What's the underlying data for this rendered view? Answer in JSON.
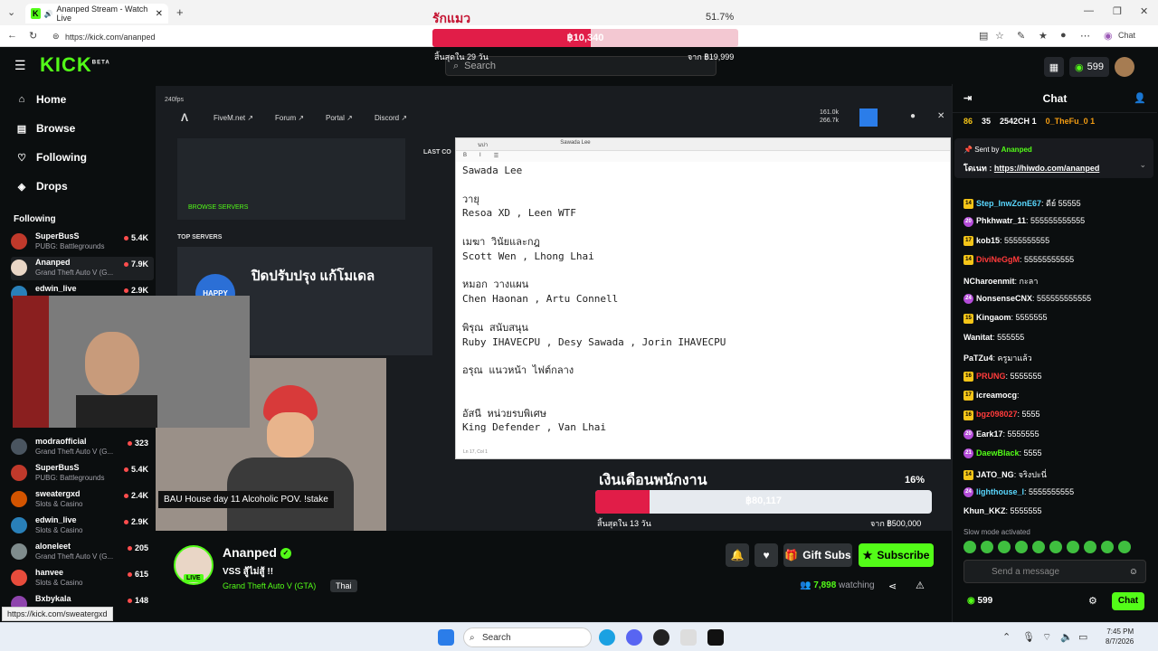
{
  "browser": {
    "tab_title": "Ananped Stream - Watch Live",
    "url": "https://kick.com/ananped",
    "chat_label": "Chat",
    "status_url": "https://kick.com/sweatergxd"
  },
  "goal": {
    "title": "รักแมว",
    "percent": "51.7%",
    "value_label": "฿10,340",
    "fill_fraction": 0.517,
    "left_caption": "สิ้นสุดใน 29 วัน",
    "right_caption": "จาก ฿19,999"
  },
  "header": {
    "logo": "KICK",
    "logo_tag": "BETA",
    "search_placeholder": "Search",
    "points": "599"
  },
  "sidebar": {
    "nav": [
      {
        "label": "Home",
        "icon": "home-icon"
      },
      {
        "label": "Browse",
        "icon": "browse-icon"
      },
      {
        "label": "Following",
        "icon": "heart-icon"
      },
      {
        "label": "Drops",
        "icon": "drops-icon"
      }
    ],
    "section_title": "Following",
    "channels": [
      {
        "name": "SuperBusS",
        "game": "PUBG: Battlegrounds",
        "viewers": "5.4K"
      },
      {
        "name": "Ananped",
        "game": "Grand Theft Auto V (G...",
        "viewers": "7.9K"
      },
      {
        "name": "edwin_live",
        "game": "",
        "viewers": "2.9K"
      },
      {
        "name": "modraofficial",
        "game": "Grand Theft Auto V (G...",
        "viewers": "323"
      },
      {
        "name": "SuperBusS",
        "game": "PUBG: Battlegrounds",
        "viewers": "5.4K"
      },
      {
        "name": "sweatergxd",
        "game": "Slots & Casino",
        "viewers": "2.4K"
      },
      {
        "name": "edwin_live",
        "game": "Slots & Casino",
        "viewers": "2.9K"
      },
      {
        "name": "aloneleet",
        "game": "Grand Theft Auto V (G...",
        "viewers": "205"
      },
      {
        "name": "hanvee",
        "game": "Slots & Casino",
        "viewers": "615"
      },
      {
        "name": "Bxbykala",
        "game": "",
        "viewers": "148"
      }
    ]
  },
  "video": {
    "fps": "240fps",
    "top_links": [
      "FiveM.net ↗",
      "Forum ↗",
      "Portal ↗",
      "Discord ↗"
    ],
    "stats": [
      "161.0k",
      "266.7k"
    ],
    "browse_servers": "BROWSE SERVERS",
    "last_connected": "LAST CO",
    "top_servers": "TOP SERVERS",
    "banner_title": "ปิดปรับปรุง แก้โมเดล",
    "banner_logo": "HAPPY",
    "caption": "BAU House day 11 Alcoholic POV. !stake",
    "notepad_lines": "Sawada Lee\n\nวายุ\nResoa XD , Leen WTF\n\nเมฆา วินัยและกฎ\nScott Wen , Lhong Lhai\n\nหมอก วางแผน\nChen Haonan , Artu Connell\n\nพิรุณ สนับสนุน\nRuby IHAVECPU , Desy Sawada , Jorin IHAVECPU\n\nอรุณ แนวหน้า ไฟต์กลาง\n\n\nอัสนี หน่วยรบพิเศษ\nKing Defender , Van Lhai",
    "notepad_tab1": "นบ่า",
    "notepad_tab2": "Sawada Lee",
    "notepad_status": "Ln 17, Col 1",
    "donate_value": "฿80,117",
    "donate_fraction": 0.16,
    "donate_pct": "16%",
    "donate_banner": "เงินเดือนพนักงาน",
    "donate_left": "สิ้นสุดใน 13 วัน",
    "donate_right": "จาก ฿500,000"
  },
  "stream": {
    "name": "Ananped",
    "live": "LIVE",
    "title": "VSS สู้ไม่สู้ !!",
    "category": "Grand Theft Auto V (GTA)",
    "language": "Thai",
    "gift_label": "Gift Subs",
    "subscribe_label": "Subscribe",
    "watching": "7,898",
    "watching_suffix": "watching"
  },
  "chat": {
    "title": "Chat",
    "leaderboard": [
      {
        "rank": "86",
        "points": "35"
      },
      {
        "name": "2542CH",
        "count": "1"
      },
      {
        "name": "0_TheFu_0",
        "count": "1"
      }
    ],
    "pinned_by_label": "Sent by",
    "pinned_by": "Ananped",
    "pinned_text_prefix": "โดเนท : ",
    "pinned_link": "https://hiwdo.com/ananped",
    "messages": [
      {
        "badge": "14",
        "user": "Step_InwZonE67",
        "color": "#5ad8ff",
        "text": ": ดีย์ 55555"
      },
      {
        "badge": "20",
        "user": "Phkhwatr_11",
        "color": "#ffffff",
        "text": ": 555555555555"
      },
      {
        "badge": "17",
        "user": "kob15",
        "color": "#ffffff",
        "text": ": 5555555555"
      },
      {
        "badge": "14",
        "user": "DiviNeGgM",
        "color": "#ff3b3b",
        "text": ": 55555555555"
      },
      {
        "badge": "",
        "user": "NCharoenmit",
        "color": "#ffffff",
        "text": ": กะลา"
      },
      {
        "badge": "24",
        "user": "NonsenseCNX",
        "color": "#ffffff",
        "text": ": 555555555555"
      },
      {
        "badge": "15",
        "user": "Kingaom",
        "color": "#ffffff",
        "text": ": 5555555"
      },
      {
        "badge": "",
        "user": "Wanitat",
        "color": "#ffffff",
        "text": ": 555555"
      },
      {
        "badge": "",
        "user": "PaTZu4",
        "color": "#ffffff",
        "text": ": ครูมาแล้ว"
      },
      {
        "badge": "16",
        "user": "PRUNG",
        "color": "#ff3b3b",
        "text": ": 5555555"
      },
      {
        "badge": "17",
        "user": "icreamocg",
        "color": "#ffffff",
        "text": ":"
      },
      {
        "badge": "16",
        "user": "bgz098027",
        "color": "#ff3b3b",
        "text": ": 5555"
      },
      {
        "badge": "20",
        "user": "Eark17",
        "color": "#ffffff",
        "text": ": 5555555"
      },
      {
        "badge": "21",
        "user": "DaewBlack",
        "color": "#53fc18",
        "text": ": 5555"
      },
      {
        "badge": "14",
        "user": "JATO_NG",
        "color": "#ffffff",
        "text": ": จริงปะนี่"
      },
      {
        "badge": "24",
        "user": "lighthouse_l",
        "color": "#5ad8ff",
        "text": ": 5555555555"
      },
      {
        "badge": "",
        "user": "Khun_KKZ",
        "color": "#ffffff",
        "text": ": 5555555"
      }
    ],
    "slow_mode": "Slow mode activated",
    "input_placeholder": "Send a message",
    "points": "599",
    "send_label": "Chat"
  },
  "taskbar": {
    "search_label": "Search",
    "time": "7:45 PM",
    "date": "8/7/2026"
  }
}
